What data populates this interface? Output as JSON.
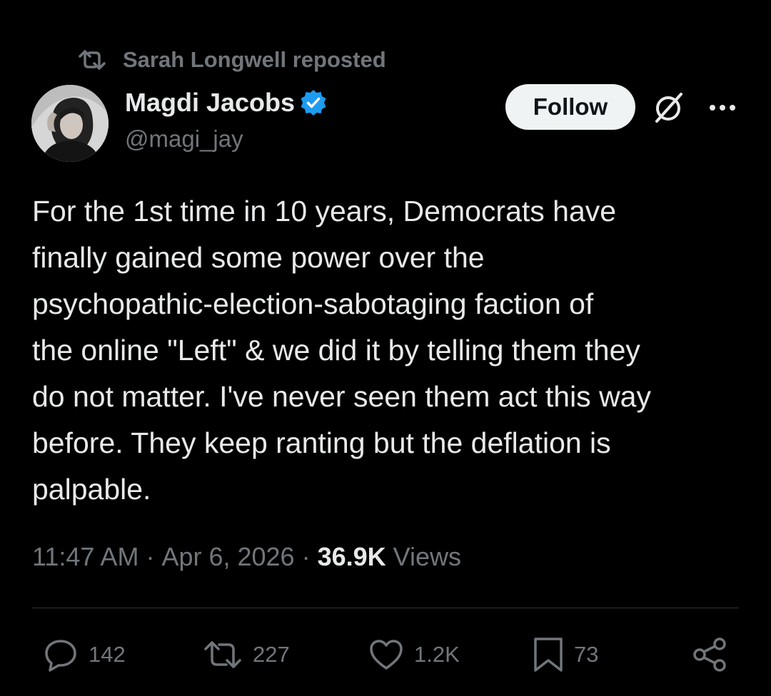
{
  "repost": {
    "icon": "repost-icon",
    "text": "Sarah Longwell reposted"
  },
  "author": {
    "avatar_icon": "avatar",
    "display_name": "Magdi Jacobs",
    "verified_icon": "verified-badge-icon",
    "verified_color": "#1d9bf0",
    "handle": "@magi_jay"
  },
  "header_actions": {
    "follow_label": "Follow",
    "grok_icon": "grok-icon",
    "more_icon": "more-options-icon"
  },
  "tweet": {
    "text": "For the 1st time in 10 years, Democrats have\nfinally gained some power over the\npsychopathic-election-sabotaging faction of\nthe online \"Left\" & we did it by telling them they\ndo not matter. I've never seen them act this way\nbefore. They keep ranting but the deflation is\npalpable."
  },
  "meta": {
    "time": "11:47 AM",
    "separator": " · ",
    "date": "Apr 6, 2026",
    "views_count": "36.9K",
    "views_label": " Views"
  },
  "actions": {
    "reply_count": "142",
    "repost_count": "227",
    "like_count": "1.2K",
    "bookmark_count": "73",
    "share_icon": "share-icon"
  },
  "colors": {
    "background": "#000000",
    "primary_text": "#e7e9ea",
    "secondary_text": "#71767b",
    "divider": "#2f3336",
    "follow_bg": "#eff3f4"
  }
}
